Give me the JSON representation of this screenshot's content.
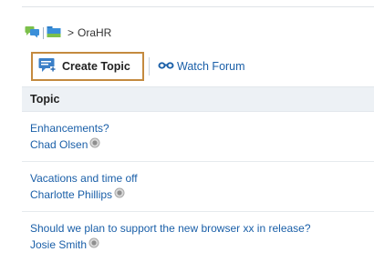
{
  "breadcrumb": {
    "separator": ">",
    "forum_name": "OraHR"
  },
  "toolbar": {
    "create_label": "Create Topic",
    "watch_label": "Watch Forum"
  },
  "table": {
    "header": "Topic",
    "rows": [
      {
        "title": "Enhancements?",
        "author": "Chad Olsen"
      },
      {
        "title": "Vacations and time off",
        "author": "Charlotte Phillips"
      },
      {
        "title": "Should we plan to support the new browser xx in release?",
        "author": "Josie Smith"
      }
    ]
  },
  "colors": {
    "link": "#1a5fa8",
    "highlight_border": "#c48a3f",
    "header_bg": "#edf1f5"
  },
  "icons": [
    "discussions-icon",
    "forum-folder-icon",
    "create-topic-icon",
    "watch-glasses-icon",
    "presence-status-icon"
  ]
}
